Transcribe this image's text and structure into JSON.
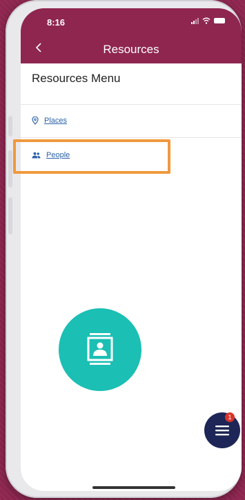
{
  "status_bar": {
    "time": "8:16"
  },
  "header": {
    "title": "Resources",
    "back_icon": "chevron-left-icon"
  },
  "menu": {
    "title": "Resources Menu",
    "items": [
      {
        "label": "Places",
        "icon": "location-pin-icon"
      },
      {
        "label": "People",
        "icon": "people-icon"
      }
    ]
  },
  "fab": {
    "badge_count": "1",
    "icon": "hamburger-menu-icon"
  },
  "colors": {
    "brand": "#8e2650",
    "accent": "#1bbfb4",
    "fab": "#1d2656",
    "highlight": "#f0993d",
    "link": "#2b62a8"
  }
}
